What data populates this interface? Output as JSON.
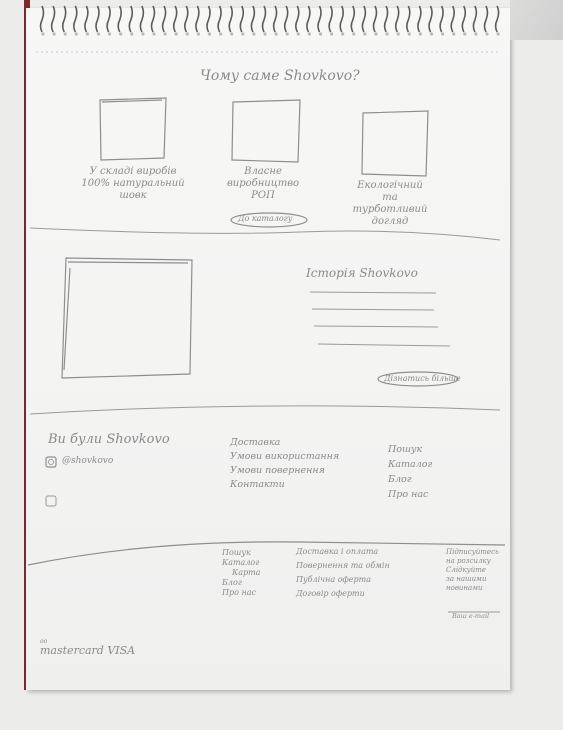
{
  "why_section": {
    "title": "Чому саме Shovkovo?",
    "features": [
      "У складі виробів 100% натуральний шовк",
      "Власне виробництво РОП",
      "Екологічний та турботливий догляд"
    ],
    "catalog_button": "До каталогу"
  },
  "history_section": {
    "title": "Історія Shovkovo",
    "more_button": "Дізнатись більше"
  },
  "social_section": {
    "title": "Ви були Shovkovo",
    "instagram": "@shovkovo"
  },
  "info_links": [
    "Доставка",
    "Умови використання",
    "Умови повернення",
    "Контакти"
  ],
  "nav_links": [
    "Пошук",
    "Каталог",
    "Блог",
    "Про нас"
  ],
  "footer": {
    "nav": [
      "Пошук",
      "Каталог",
      "Блог",
      "Про нас"
    ],
    "extra": "Карта",
    "policies": [
      "Доставка і оплата",
      "Повернення та обмін",
      "Публічна оферта",
      "Договір оферти"
    ],
    "subscribe": [
      "Підписуйтесь",
      "на розсилку",
      "Слідкуйте",
      "за нашими",
      "новинами"
    ],
    "email_placeholder": "Ваш e-mail",
    "payments": "mastercard VISA"
  }
}
